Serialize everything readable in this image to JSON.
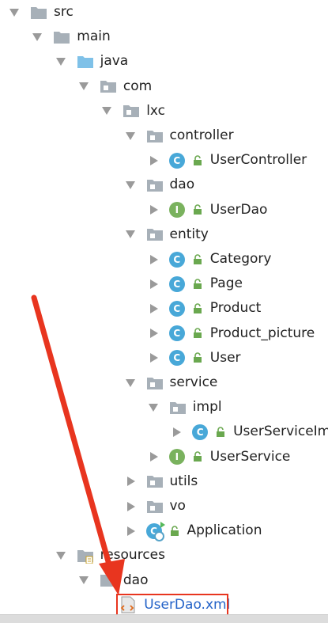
{
  "tree": [
    {
      "name": "tree-item-src",
      "label": "src",
      "icon": "folder-icon",
      "depth": 0,
      "expanded": true
    },
    {
      "name": "tree-item-main",
      "label": "main",
      "icon": "folder-icon",
      "depth": 1,
      "expanded": true
    },
    {
      "name": "tree-item-java",
      "label": "java",
      "icon": "source-folder-icon",
      "depth": 2,
      "expanded": true
    },
    {
      "name": "tree-item-com",
      "label": "com",
      "icon": "package-icon",
      "depth": 3,
      "expanded": true
    },
    {
      "name": "tree-item-lxc",
      "label": "lxc",
      "icon": "package-icon",
      "depth": 4,
      "expanded": true
    },
    {
      "name": "tree-item-controller",
      "label": "controller",
      "icon": "package-icon",
      "depth": 5,
      "expanded": true
    },
    {
      "name": "tree-item-usercontroller",
      "label": "UserController",
      "icon": "class-icon",
      "depth": 6,
      "expanded": false,
      "lock": true
    },
    {
      "name": "tree-item-dao-package",
      "label": "dao",
      "icon": "package-icon",
      "depth": 5,
      "expanded": true
    },
    {
      "name": "tree-item-userdao",
      "label": "UserDao",
      "icon": "interface-icon",
      "depth": 6,
      "expanded": false,
      "lock": true
    },
    {
      "name": "tree-item-entity",
      "label": "entity",
      "icon": "package-icon",
      "depth": 5,
      "expanded": true
    },
    {
      "name": "tree-item-category",
      "label": "Category",
      "icon": "class-icon",
      "depth": 6,
      "expanded": false,
      "lock": true
    },
    {
      "name": "tree-item-page",
      "label": "Page",
      "icon": "class-icon",
      "depth": 6,
      "expanded": false,
      "lock": true
    },
    {
      "name": "tree-item-product",
      "label": "Product",
      "icon": "class-icon",
      "depth": 6,
      "expanded": false,
      "lock": true
    },
    {
      "name": "tree-item-product-picture",
      "label": "Product_picture",
      "icon": "class-icon",
      "depth": 6,
      "expanded": false,
      "lock": true
    },
    {
      "name": "tree-item-user",
      "label": "User",
      "icon": "class-icon",
      "depth": 6,
      "expanded": false,
      "lock": true
    },
    {
      "name": "tree-item-service",
      "label": "service",
      "icon": "package-icon",
      "depth": 5,
      "expanded": true
    },
    {
      "name": "tree-item-impl",
      "label": "impl",
      "icon": "package-icon",
      "depth": 6,
      "expanded": true
    },
    {
      "name": "tree-item-userserviceimpl",
      "label": "UserServiceImp",
      "icon": "class-icon",
      "depth": 7,
      "expanded": false,
      "lock": true
    },
    {
      "name": "tree-item-userservice",
      "label": "UserService",
      "icon": "interface-icon",
      "depth": 6,
      "expanded": false,
      "lock": true
    },
    {
      "name": "tree-item-utils",
      "label": "utils",
      "icon": "package-icon",
      "depth": 5,
      "expanded": false
    },
    {
      "name": "tree-item-vo",
      "label": "vo",
      "icon": "package-icon",
      "depth": 5,
      "expanded": false
    },
    {
      "name": "tree-item-application",
      "label": "Application",
      "icon": "spring-boot-class-icon",
      "depth": 5,
      "expanded": false,
      "lock": true
    },
    {
      "name": "tree-item-resources",
      "label": "resources",
      "icon": "resources-folder-icon",
      "depth": 2,
      "expanded": true
    },
    {
      "name": "tree-item-dao-resources",
      "label": "dao",
      "icon": "folder-icon",
      "depth": 3,
      "expanded": true
    },
    {
      "name": "tree-item-userdao-xml",
      "label": "UserDao.xml",
      "icon": "xml-file-icon",
      "depth": 4,
      "leaf": true,
      "selected": true
    }
  ],
  "colors": {
    "folder": "#a7b0b8",
    "source_folder": "#7fc1e8",
    "class_badge": "#48a8d8",
    "interface_badge": "#7ab25e",
    "lock": "#6aa84f",
    "arrow": "#9a9a9a",
    "highlight": "#e8351f",
    "selected_text": "#2463c8"
  },
  "badges": {
    "class": "C",
    "interface": "I"
  }
}
